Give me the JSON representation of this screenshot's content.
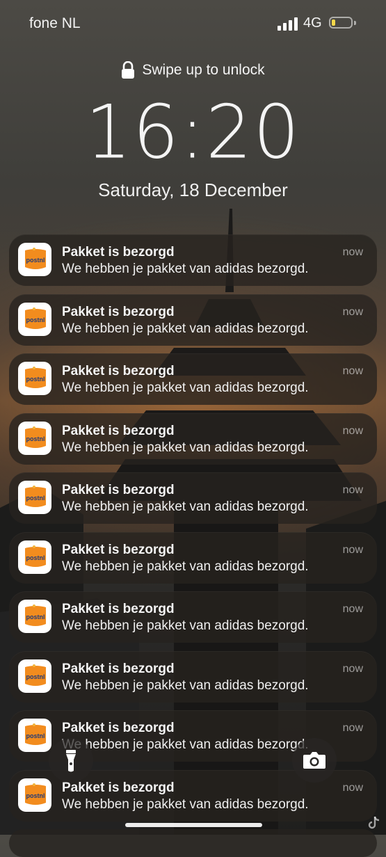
{
  "status_bar": {
    "carrier": "fone NL",
    "network": "4G",
    "battery_level": 0.2,
    "signal_bars": 4,
    "battery_fill_color": "#f5d84a"
  },
  "lock_screen": {
    "unlock_hint": "Swipe up to unlock",
    "time": "16:20",
    "date": "Saturday, 18 December"
  },
  "notifications": [
    {
      "app": "postnl",
      "app_icon_text": "postnl",
      "title": "Pakket is bezorgd",
      "body": "We hebben je pakket van adidas bezorgd.",
      "time": "now"
    },
    {
      "app": "postnl",
      "app_icon_text": "postnl",
      "title": "Pakket is bezorgd",
      "body": "We hebben je pakket van adidas bezorgd.",
      "time": "now"
    },
    {
      "app": "postnl",
      "app_icon_text": "postnl",
      "title": "Pakket is bezorgd",
      "body": "We hebben je pakket van adidas bezorgd.",
      "time": "now"
    },
    {
      "app": "postnl",
      "app_icon_text": "postnl",
      "title": "Pakket is bezorgd",
      "body": "We hebben je pakket van adidas bezorgd.",
      "time": "now"
    },
    {
      "app": "postnl",
      "app_icon_text": "postnl",
      "title": "Pakket is bezorgd",
      "body": "We hebben je pakket van adidas bezorgd.",
      "time": "now"
    },
    {
      "app": "postnl",
      "app_icon_text": "postnl",
      "title": "Pakket is bezorgd",
      "body": "We hebben je pakket van adidas bezorgd.",
      "time": "now"
    },
    {
      "app": "postnl",
      "app_icon_text": "postnl",
      "title": "Pakket is bezorgd",
      "body": "We hebben je pakket van adidas bezorgd.",
      "time": "now"
    },
    {
      "app": "postnl",
      "app_icon_text": "postnl",
      "title": "Pakket is bezorgd",
      "body": "We hebben je pakket van adidas bezorgd.",
      "time": "now"
    },
    {
      "app": "postnl",
      "app_icon_text": "postnl",
      "title": "Pakket is bezorgd",
      "body": "We hebben je pakket van adidas bezorgd.",
      "time": "now"
    },
    {
      "app": "postnl",
      "app_icon_text": "postnl",
      "title": "Pakket is bezorgd",
      "body": "We hebben je pakket van adidas bezorgd.",
      "time": "now"
    }
  ],
  "controls": {
    "flashlight_icon": "flashlight-icon",
    "camera_icon": "camera-icon"
  },
  "colors": {
    "postnl_orange": "#f28c1e",
    "postnl_blue": "#1f3a7a"
  }
}
